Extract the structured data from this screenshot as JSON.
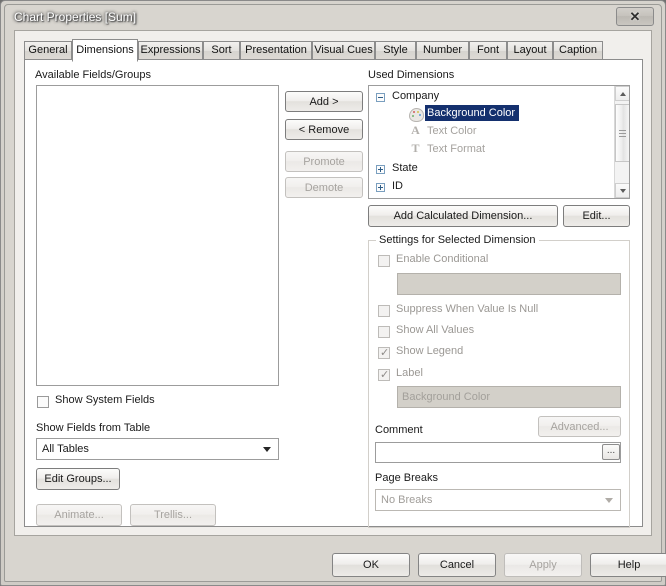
{
  "window": {
    "title": "Chart Properties [Sum]",
    "close_label": "✕"
  },
  "tabs": [
    {
      "label": "General",
      "active": false
    },
    {
      "label": "Dimensions",
      "active": true
    },
    {
      "label": "Expressions",
      "active": false
    },
    {
      "label": "Sort",
      "active": false
    },
    {
      "label": "Presentation",
      "active": false
    },
    {
      "label": "Visual Cues",
      "active": false
    },
    {
      "label": "Style",
      "active": false
    },
    {
      "label": "Number",
      "active": false
    },
    {
      "label": "Font",
      "active": false
    },
    {
      "label": "Layout",
      "active": false
    },
    {
      "label": "Caption",
      "active": false
    }
  ],
  "left": {
    "available_label": "Available Fields/Groups",
    "available_items": [],
    "show_system_fields_label": "Show System Fields",
    "show_system_fields_checked": false,
    "show_fields_from_table_label": "Show Fields from Table",
    "table_filter_value": "All Tables",
    "edit_groups_label": "Edit Groups...",
    "animate_label": "Animate...",
    "trellis_label": "Trellis..."
  },
  "middle_buttons": {
    "add_label": "Add >",
    "remove_label": "< Remove",
    "promote_label": "Promote",
    "demote_label": "Demote"
  },
  "right": {
    "used_dimensions_label": "Used Dimensions",
    "tree": [
      {
        "label": "Company",
        "level": 0,
        "expander": "minus",
        "icon": "none",
        "state": "normal"
      },
      {
        "label": "Background Color",
        "level": 1,
        "expander": "none",
        "icon": "palette-icon",
        "state": "selected"
      },
      {
        "label": "Text Color",
        "level": 1,
        "expander": "none",
        "icon": "text-color-icon",
        "state": "disabled"
      },
      {
        "label": "Text Format",
        "level": 1,
        "expander": "none",
        "icon": "text-format-icon",
        "state": "disabled"
      },
      {
        "label": "State",
        "level": 0,
        "expander": "plus",
        "icon": "none",
        "state": "normal"
      },
      {
        "label": "ID",
        "level": 0,
        "expander": "plus",
        "icon": "none",
        "state": "normal"
      }
    ],
    "add_calculated_label": "Add Calculated Dimension...",
    "edit_label": "Edit...",
    "settings_group_label": "Settings for Selected Dimension",
    "enable_conditional_label": "Enable Conditional",
    "enable_conditional_checked": false,
    "conditional_expression_value": "",
    "suppress_null_label": "Suppress When Value Is Null",
    "suppress_null_checked": false,
    "show_all_values_label": "Show All Values",
    "show_all_values_checked": false,
    "show_legend_label": "Show Legend",
    "show_legend_checked": true,
    "label_checkbox_label": "Label",
    "label_checkbox_checked": true,
    "label_value": "Background Color",
    "comment_label": "Comment",
    "comment_value": "",
    "comment_browse_label": "...",
    "advanced_label": "Advanced...",
    "page_breaks_label": "Page Breaks",
    "page_breaks_value": "No Breaks"
  },
  "footer": {
    "ok_label": "OK",
    "cancel_label": "Cancel",
    "apply_label": "Apply",
    "help_label": "Help"
  },
  "colors": {
    "selection": "#14306e",
    "dialog_bg": "#d8d5cf",
    "panel_bg": "#ffffff",
    "disabled_text": "#a5a29e"
  }
}
